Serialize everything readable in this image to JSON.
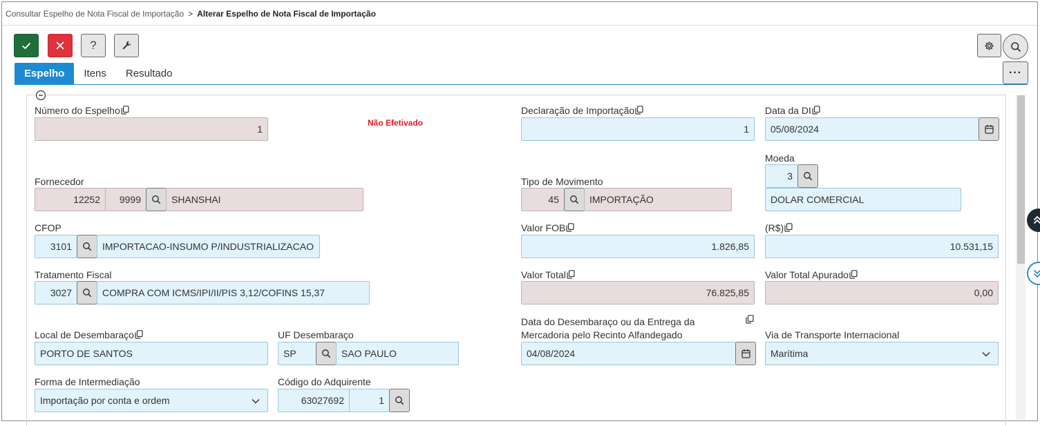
{
  "breadcrumb": {
    "parent": "Consultar Espelho de Nota Fiscal de Importação",
    "separator": ">",
    "current": "Alterar Espelho de Nota Fiscal de Importação"
  },
  "toolbar": {
    "help_label": "?",
    "more_label": "···"
  },
  "tabs": [
    {
      "label": "Espelho",
      "active": true
    },
    {
      "label": "Itens",
      "active": false
    },
    {
      "label": "Resultado",
      "active": false
    }
  ],
  "form": {
    "numero_espelho": {
      "label": "Número do Espelho",
      "value": "1"
    },
    "status": "Não Efetivado",
    "declaracao_importacao": {
      "label": "Declaração de Importação",
      "value": "1"
    },
    "data_di": {
      "label": "Data da DI",
      "value": "05/08/2024"
    },
    "moeda": {
      "label": "Moeda",
      "code": "3",
      "description": "DOLAR COMERCIAL"
    },
    "fornecedor": {
      "label": "Fornecedor",
      "code": "12252",
      "branch": "9999",
      "name": "SHANSHAI"
    },
    "tipo_movimento": {
      "label": "Tipo de Movimento",
      "code": "45",
      "description": "IMPORTAÇÃO"
    },
    "cfop": {
      "label": "CFOP",
      "code": "3101",
      "description": "IMPORTACAO-INSUMO P/INDUSTRIALIZACAO"
    },
    "valor_fob": {
      "label": "Valor FOB",
      "value": "1.826,85"
    },
    "valor_rs": {
      "label": "(R$)",
      "value": "10.531,15"
    },
    "tratamento_fiscal": {
      "label": "Tratamento Fiscal",
      "code": "3027",
      "description": "COMPRA COM ICMS/IPI/II/PIS 3,12/COFINS 15,37"
    },
    "valor_total": {
      "label": "Valor Total",
      "value": "76.825,85"
    },
    "valor_total_apurado": {
      "label": "Valor Total Apurado",
      "value": "0,00"
    },
    "local_desembaraco": {
      "label": "Local de Desembaraço",
      "value": "PORTO DE SANTOS"
    },
    "uf_desembaraco": {
      "label": "UF Desembaraço",
      "code": "SP",
      "description": "SAO PAULO"
    },
    "data_desembaraco": {
      "label_line1": "Data do Desembaraço ou da Entrega da",
      "label_line2": "Mercadoria pelo Recinto Alfandegado",
      "value": "04/08/2024"
    },
    "via_transporte": {
      "label": "Via de Transporte Internacional",
      "value": "Marítima"
    },
    "forma_intermediacao": {
      "label": "Forma de Intermediação",
      "value": "Importação por conta e ordem"
    },
    "codigo_adquirente": {
      "label": "Código do Adquirente",
      "code": "63027692",
      "branch": "1"
    }
  },
  "colors": {
    "tab_active": "#1e8ad0",
    "ok_button": "#1f6f3b",
    "cancel_button": "#e0323a",
    "readonly_field": "#e9dcdc",
    "editable_field": "#e2f3fc",
    "status_text": "#e01b24"
  }
}
